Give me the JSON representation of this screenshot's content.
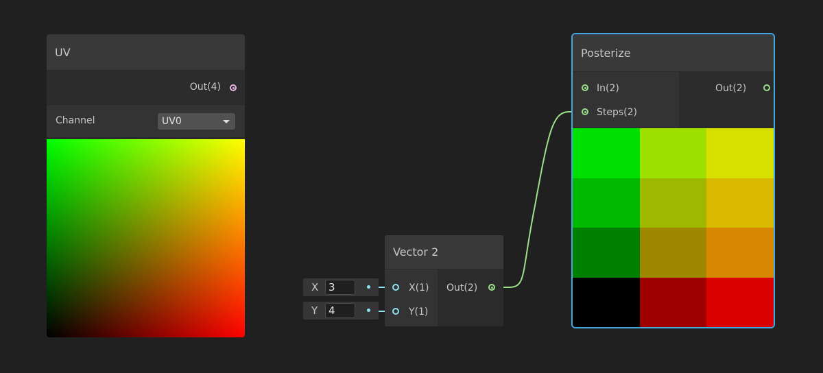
{
  "uv_node": {
    "title": "UV",
    "output_label": "Out(4)",
    "channel_label": "Channel",
    "channel_value": "UV0"
  },
  "vector2_node": {
    "title": "Vector 2",
    "inputs": [
      {
        "label": "X(1)",
        "axis": "X",
        "value": "3"
      },
      {
        "label": "Y(1)",
        "axis": "Y",
        "value": "4"
      }
    ],
    "output_label": "Out(2)"
  },
  "posterize_node": {
    "title": "Posterize",
    "inputs": [
      {
        "label": "In(2)"
      },
      {
        "label": "Steps(2)"
      }
    ],
    "output_label": "Out(2)",
    "preview_colors": [
      [
        "#00e000",
        "#9ee000",
        "#d8e000"
      ],
      [
        "#00b800",
        "#9eb800",
        "#d8b800"
      ],
      [
        "#008000",
        "#9e8800",
        "#d88800"
      ],
      [
        "#000000",
        "#9e0000",
        "#d80000"
      ]
    ]
  },
  "colors": {
    "background": "#202020",
    "selection_outline": "#44a6e0",
    "vector4_port": "#e8b4e2",
    "vector2_port": "#9ce08a",
    "vector1_port": "#8fe2ef"
  }
}
